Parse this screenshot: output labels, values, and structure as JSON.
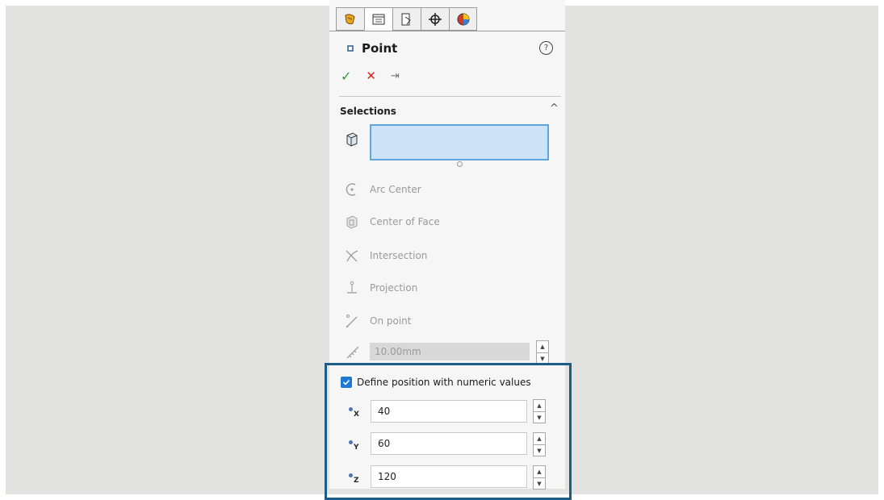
{
  "tabs": [
    {
      "icon": "feature-manager-icon"
    },
    {
      "icon": "property-manager-icon"
    },
    {
      "icon": "configuration-manager-icon"
    },
    {
      "icon": "dimxpert-manager-icon"
    },
    {
      "icon": "display-manager-icon"
    }
  ],
  "header": {
    "title": "Point",
    "help": "?"
  },
  "actions": {
    "ok": "✓",
    "cancel": "✕",
    "pin": "⇥"
  },
  "selections": {
    "title": "Selections",
    "collapse": "^",
    "options": [
      {
        "label": "Arc Center",
        "icon": "arc-center-icon"
      },
      {
        "label": "Center of Face",
        "icon": "center-of-face-icon"
      },
      {
        "label": "Intersection",
        "icon": "intersection-icon"
      },
      {
        "label": "Projection",
        "icon": "projection-icon"
      },
      {
        "label": "On point",
        "icon": "on-point-icon"
      }
    ],
    "distance_value": "10.00mm"
  },
  "numeric": {
    "checkbox_label": "Define position with numeric values",
    "checked": true,
    "coords": [
      {
        "axis": "X",
        "value": "40"
      },
      {
        "axis": "Y",
        "value": "60"
      },
      {
        "axis": "Z",
        "value": "120"
      }
    ]
  },
  "colors": {
    "highlight_border": "#1d5c86",
    "selection_fill": "#cde4f8",
    "checkbox": "#1f78d1"
  }
}
